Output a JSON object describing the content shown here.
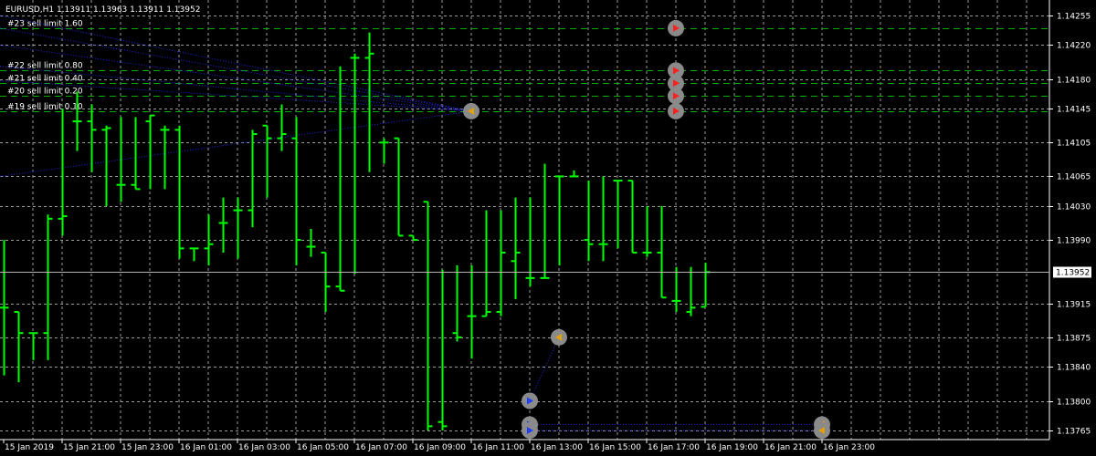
{
  "window": {
    "title": "EURUSD,H1  1.13911 1.13963 1.13911 1.13952"
  },
  "icons": {
    "order-marker": "order-marker-icon"
  },
  "chart_data": {
    "type": "bar",
    "symbol": "EURUSD",
    "timeframe": "H1",
    "ylim": [
      1.1374,
      1.1429
    ],
    "y_ticks": [
      "1.14255",
      "1.14220",
      "1.14180",
      "1.14145",
      "1.14105",
      "1.14065",
      "1.14030",
      "1.13990",
      "1.13952",
      "1.13915",
      "1.13875",
      "1.13840",
      "1.13800",
      "1.13765"
    ],
    "x_ticks": [
      "15 Jan 2019",
      "15 Jan 21:00",
      "15 Jan 23:00",
      "16 Jan 01:00",
      "16 Jan 03:00",
      "16 Jan 05:00",
      "16 Jan 07:00",
      "16 Jan 09:00",
      "16 Jan 11:00",
      "16 Jan 13:00",
      "16 Jan 15:00",
      "16 Jan 17:00",
      "16 Jan 19:00",
      "16 Jan 21:00",
      "16 Jan 23:00"
    ],
    "current_price": "1.13952",
    "grid": true,
    "colors": {
      "bars": "#00ff00",
      "grid": "#9a9a9a",
      "order_line": "#00b000",
      "current_line": "#b4b4b4",
      "trade_line": "#2626e0",
      "background": "#000000"
    },
    "bars": [
      {
        "o": 1.1391,
        "h": 1.1399,
        "l": 1.1383,
        "c": 1.1391
      },
      {
        "o": 1.13905,
        "h": 1.13905,
        "l": 1.13822,
        "c": 1.1388
      },
      {
        "o": 1.1388,
        "h": 1.1388,
        "l": 1.13848,
        "c": 1.1388
      },
      {
        "o": 1.1388,
        "h": 1.1402,
        "l": 1.13848,
        "c": 1.14015
      },
      {
        "o": 1.14015,
        "h": 1.14145,
        "l": 1.13995,
        "c": 1.14018
      },
      {
        "o": 1.1413,
        "h": 1.14165,
        "l": 1.14095,
        "c": 1.1413
      },
      {
        "o": 1.1413,
        "h": 1.1415,
        "l": 1.1407,
        "c": 1.1412
      },
      {
        "o": 1.1412,
        "h": 1.14125,
        "l": 1.1403,
        "c": 1.14122
      },
      {
        "o": 1.14055,
        "h": 1.14135,
        "l": 1.14035,
        "c": 1.14055
      },
      {
        "o": 1.14055,
        "h": 1.14135,
        "l": 1.1405,
        "c": 1.1405
      },
      {
        "o": 1.1413,
        "h": 1.14137,
        "l": 1.1405,
        "c": 1.14137
      },
      {
        "o": 1.1412,
        "h": 1.14125,
        "l": 1.1405,
        "c": 1.1412
      },
      {
        "o": 1.1412,
        "h": 1.14125,
        "l": 1.13968,
        "c": 1.1398
      },
      {
        "o": 1.1398,
        "h": 1.1398,
        "l": 1.13965,
        "c": 1.1398
      },
      {
        "o": 1.1398,
        "h": 1.1402,
        "l": 1.1396,
        "c": 1.13985
      },
      {
        "o": 1.1401,
        "h": 1.1404,
        "l": 1.13975,
        "c": 1.1401
      },
      {
        "o": 1.14025,
        "h": 1.1404,
        "l": 1.13968,
        "c": 1.14025
      },
      {
        "o": 1.14025,
        "h": 1.1412,
        "l": 1.14005,
        "c": 1.14115
      },
      {
        "o": 1.14125,
        "h": 1.14125,
        "l": 1.1404,
        "c": 1.1411
      },
      {
        "o": 1.1411,
        "h": 1.1415,
        "l": 1.14095,
        "c": 1.14115
      },
      {
        "o": 1.1411,
        "h": 1.14135,
        "l": 1.1396,
        "c": 1.1399
      },
      {
        "o": 1.13982,
        "h": 1.14003,
        "l": 1.1397,
        "c": 1.13982
      },
      {
        "o": 1.13975,
        "h": 1.13975,
        "l": 1.13905,
        "c": 1.13935
      },
      {
        "o": 1.13935,
        "h": 1.14195,
        "l": 1.1393,
        "c": 1.1393
      },
      {
        "o": 1.14205,
        "h": 1.1421,
        "l": 1.1395,
        "c": 1.14205
      },
      {
        "o": 1.14205,
        "h": 1.14235,
        "l": 1.1407,
        "c": 1.1421
      },
      {
        "o": 1.14105,
        "h": 1.1411,
        "l": 1.1408,
        "c": 1.14105
      },
      {
        "o": 1.1411,
        "h": 1.1411,
        "l": 1.13995,
        "c": 1.13995
      },
      {
        "o": 1.13995,
        "h": 1.13995,
        "l": 1.1399,
        "c": 1.1399
      },
      {
        "o": 1.14035,
        "h": 1.14035,
        "l": 1.13765,
        "c": 1.1377
      },
      {
        "o": 1.13775,
        "h": 1.13955,
        "l": 1.13765,
        "c": 1.1377
      },
      {
        "o": 1.1388,
        "h": 1.1396,
        "l": 1.1387,
        "c": 1.13875
      },
      {
        "o": 1.139,
        "h": 1.1396,
        "l": 1.1385,
        "c": 1.139
      },
      {
        "o": 1.139,
        "h": 1.14025,
        "l": 1.139,
        "c": 1.13905
      },
      {
        "o": 1.13905,
        "h": 1.14025,
        "l": 1.139,
        "c": 1.13975
      },
      {
        "o": 1.13965,
        "h": 1.1404,
        "l": 1.1392,
        "c": 1.13975
      },
      {
        "o": 1.13945,
        "h": 1.1404,
        "l": 1.13935,
        "c": 1.13945
      },
      {
        "o": 1.13945,
        "h": 1.1408,
        "l": 1.13945,
        "c": 1.13945
      },
      {
        "o": 1.14065,
        "h": 1.14065,
        "l": 1.1396,
        "c": 1.14065
      },
      {
        "o": 1.14065,
        "h": 1.14072,
        "l": 1.14065,
        "c": 1.14065
      },
      {
        "o": 1.1399,
        "h": 1.1406,
        "l": 1.13965,
        "c": 1.13985
      },
      {
        "o": 1.13985,
        "h": 1.14065,
        "l": 1.13965,
        "c": 1.13985
      },
      {
        "o": 1.1406,
        "h": 1.1406,
        "l": 1.1398,
        "c": 1.1406
      },
      {
        "o": 1.1406,
        "h": 1.1406,
        "l": 1.13975,
        "c": 1.13975
      },
      {
        "o": 1.13975,
        "h": 1.1403,
        "l": 1.1397,
        "c": 1.13975
      },
      {
        "o": 1.13975,
        "h": 1.1403,
        "l": 1.13922,
        "c": 1.13922
      },
      {
        "o": 1.13918,
        "h": 1.13958,
        "l": 1.13905,
        "c": 1.13918
      },
      {
        "o": 1.13905,
        "h": 1.13958,
        "l": 1.139,
        "c": 1.1391
      },
      {
        "o": 1.13911,
        "h": 1.13963,
        "l": 1.13911,
        "c": 1.13952
      }
    ],
    "orders": [
      {
        "label": "#23 sell limit 1.60",
        "price": 1.1424
      },
      {
        "label": "#22 sell limit 0.80",
        "price": 1.1419
      },
      {
        "label": "#21 sell limit 0.40",
        "price": 1.14175
      },
      {
        "label": "#20 sell limit 0.20",
        "price": 1.1416
      },
      {
        "label": "#19 sell limit 0.10",
        "price": 1.14142
      }
    ]
  }
}
